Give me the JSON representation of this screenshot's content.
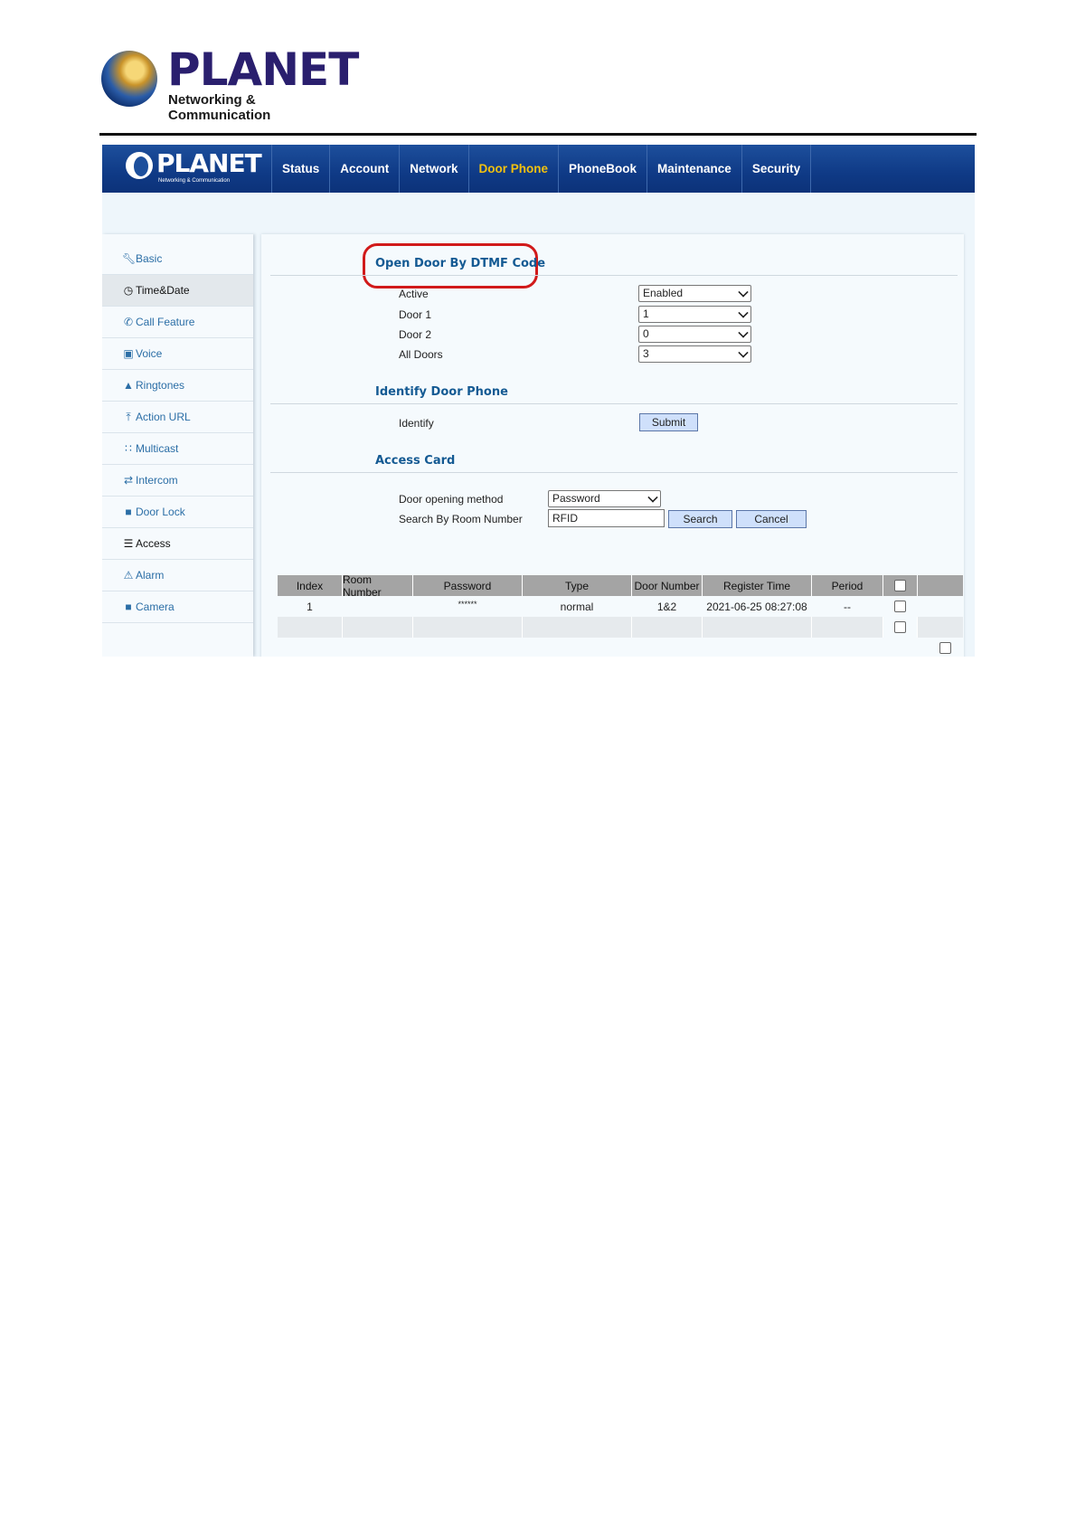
{
  "doc_header": {
    "logo_name": "PLANET",
    "logo_tagline": "Networking & Communication"
  },
  "topbar": {
    "brand_name": "PLANET",
    "brand_tagline": "Networking & Communication",
    "nav": [
      "Status",
      "Account",
      "Network",
      "Door Phone",
      "PhoneBook",
      "Maintenance",
      "Security"
    ],
    "active_nav": "Door Phone"
  },
  "sidebar": {
    "items": [
      {
        "label": "Basic",
        "icon": "wrench-icon"
      },
      {
        "label": "Time&Date",
        "icon": "clock-icon"
      },
      {
        "label": "Call Feature",
        "icon": "phone-icon"
      },
      {
        "label": "Voice",
        "icon": "voice-icon"
      },
      {
        "label": "Ringtones",
        "icon": "bell-icon"
      },
      {
        "label": "Action URL",
        "icon": "upload-icon"
      },
      {
        "label": "Multicast",
        "icon": "grid-icon"
      },
      {
        "label": "Intercom",
        "icon": "swap-icon"
      },
      {
        "label": "Door Lock",
        "icon": "lock-icon"
      },
      {
        "label": "Access",
        "icon": "card-icon"
      },
      {
        "label": "Alarm",
        "icon": "warning-icon"
      },
      {
        "label": "Camera",
        "icon": "camera-icon"
      }
    ]
  },
  "dtmf": {
    "title": "Open Door By DTMF Code",
    "active_label": "Active",
    "active_value": "Enabled",
    "door1_label": "Door 1",
    "door1_value": "1",
    "door2_label": "Door 2",
    "door2_value": "0",
    "all_label": "All Doors",
    "all_value": "3"
  },
  "identify": {
    "title": "Identify Door Phone",
    "label": "Identify",
    "button": "Submit"
  },
  "access": {
    "title": "Access Card",
    "method_label": "Door opening method",
    "method_value": "Password",
    "search_label": "Search By Room Number",
    "search_value": "RFID",
    "search_button": "Search",
    "cancel_button": "Cancel",
    "columns": [
      "Index",
      "Room Number",
      "Password",
      "Type",
      "Door Number",
      "Register Time",
      "Period"
    ],
    "rows": [
      {
        "index": "1",
        "room": "",
        "password": "******",
        "type": "normal",
        "door": "1&2",
        "time": "2021-06-25 08:27:08",
        "period": "--"
      }
    ]
  },
  "colors": {
    "nav_bg": "#0f3a86",
    "nav_active": "#f2c10f",
    "section_title": "#145a93",
    "highlight": "#d11a1a"
  }
}
